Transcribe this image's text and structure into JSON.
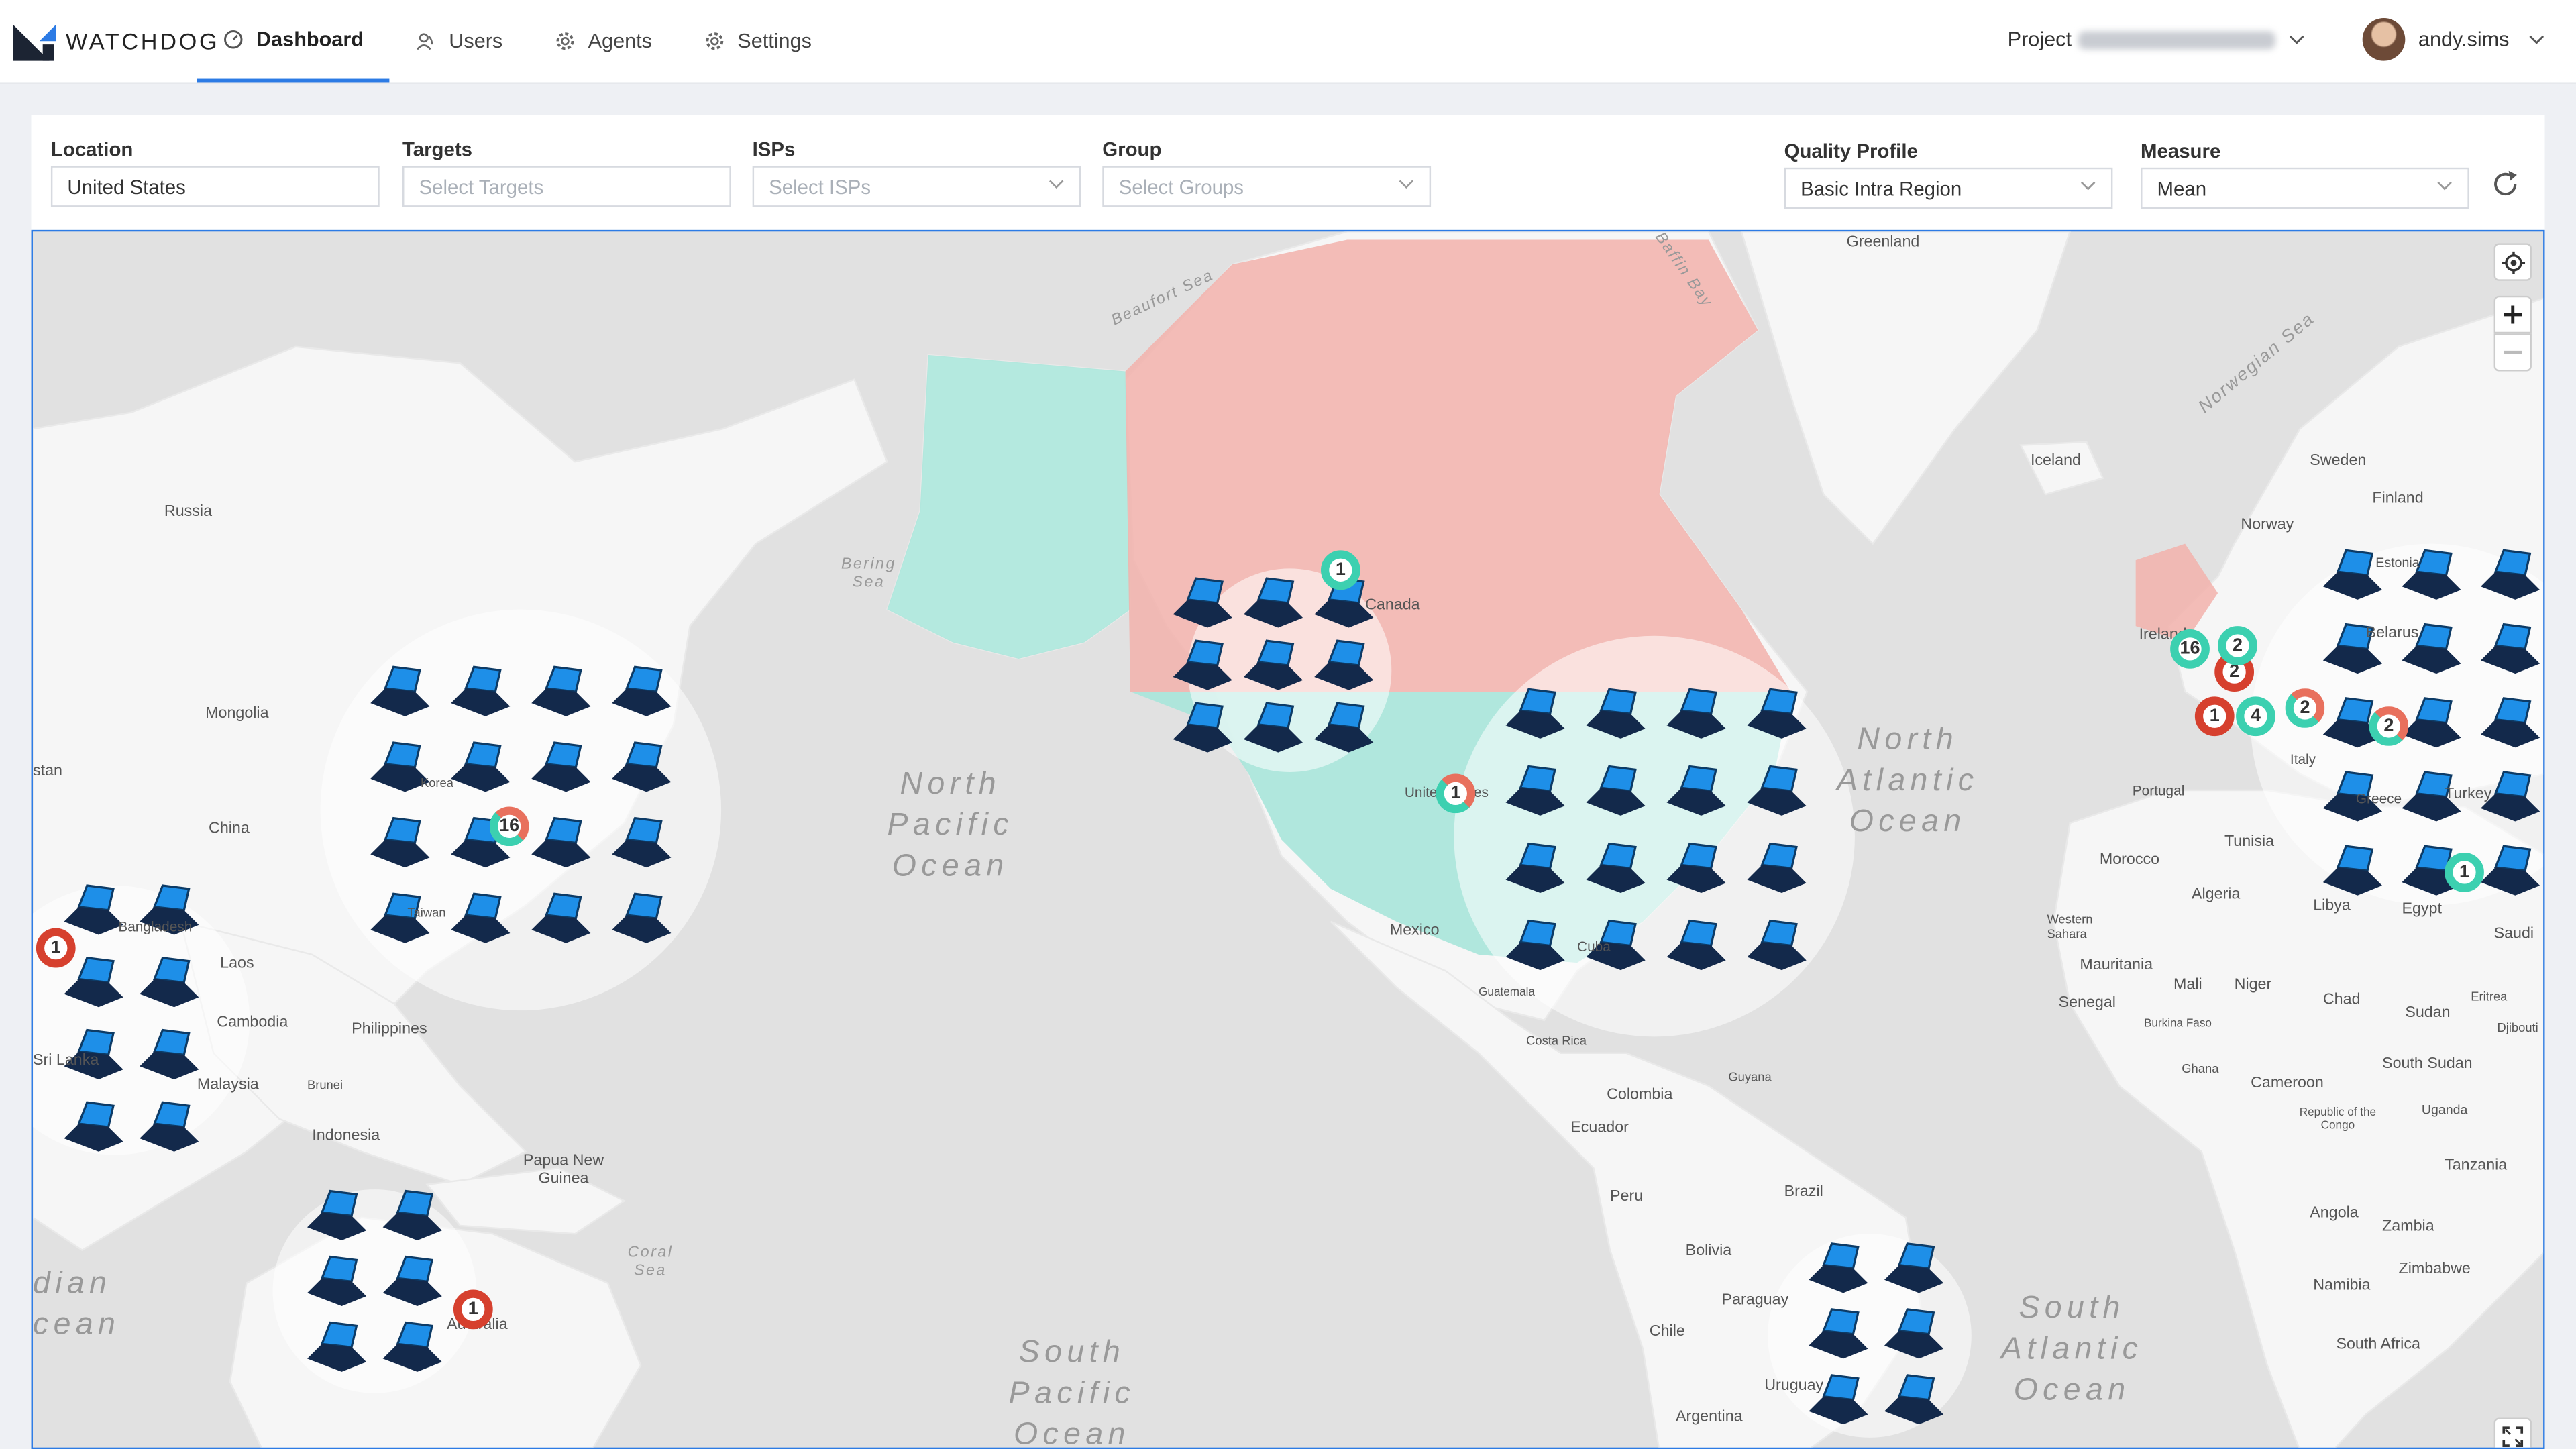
{
  "header": {
    "brand": "WATCHDOG",
    "nav": [
      {
        "label": "Dashboard",
        "icon": "gauge-icon",
        "active": true
      },
      {
        "label": "Users",
        "icon": "users-icon",
        "active": false
      },
      {
        "label": "Agents",
        "icon": "gear-icon",
        "active": false
      },
      {
        "label": "Settings",
        "icon": "gear-icon",
        "active": false
      }
    ],
    "project_label": "Project",
    "username": "andy.sims"
  },
  "filters": {
    "location": {
      "label": "Location",
      "value": "United States"
    },
    "targets": {
      "label": "Targets",
      "placeholder": "Select Targets"
    },
    "isps": {
      "label": "ISPs",
      "placeholder": "Select ISPs"
    },
    "group": {
      "label": "Group",
      "placeholder": "Select Groups"
    },
    "quality_profile": {
      "label": "Quality Profile",
      "value": "Basic Intra Region"
    },
    "measure": {
      "label": "Measure",
      "value": "Mean"
    }
  },
  "map": {
    "colors": {
      "good": "#3cd0b0",
      "bad": "#d6402e",
      "region_good": "#a8e6da",
      "region_bad": "#f2b1ab",
      "ocean": "#e1e1e1",
      "land": "#f6f6f6"
    },
    "country_labels": [
      "Greenland",
      "Russia",
      "Mongolia",
      "China",
      "Korea",
      "Taiwan",
      "Bangladesh",
      "Laos",
      "Cambodia",
      "Sri Lanka",
      "Malaysia",
      "Philippines",
      "Brunei",
      "Indonesia",
      "Papua New Guinea",
      "Canada",
      "United States",
      "Mexico",
      "Cuba",
      "Guatemala",
      "Costa Rica",
      "Colombia",
      "Guyana",
      "Ecuador",
      "Peru",
      "Brazil",
      "Bolivia",
      "Paraguay",
      "Chile",
      "Uruguay",
      "Argentina",
      "Iceland",
      "Sweden",
      "Finland",
      "Norway",
      "Estonia",
      "Belarus",
      "Ireland",
      "Portugal",
      "Italy",
      "Greece",
      "Turkey",
      "Tunisia",
      "Morocco",
      "Algeria",
      "Libya",
      "Egypt",
      "Western Sahara",
      "Mauritania",
      "Mali",
      "Niger",
      "Chad",
      "Sudan",
      "Eritrea",
      "Djibouti",
      "Senegal",
      "Burkina Faso",
      "Ghana",
      "Cameroon",
      "South Sudan",
      "Republic of the Congo",
      "Uganda",
      "Tanzania",
      "Angola",
      "Zambia",
      "Zimbabwe",
      "Namibia",
      "South Africa",
      "Saudi",
      "Australia",
      "stan"
    ],
    "oceans": [
      "North\nPacific\nOcean",
      "North\nAtlantic\nOcean",
      "South\nPacific\nOcean",
      "South\nAtlantic\nOcean",
      "dian\ncean"
    ],
    "seas": [
      "Beaufort Sea",
      "Baffin Bay",
      "Bering\nSea",
      "Norwegian Sea",
      "Coral\nSea"
    ],
    "clusters": [
      {
        "count": "1"
      },
      {
        "count": "16"
      },
      {
        "count": "1"
      },
      {
        "count": "1"
      },
      {
        "count": "16"
      },
      {
        "count": "2"
      },
      {
        "count": "2"
      },
      {
        "count": "1"
      },
      {
        "count": "4"
      },
      {
        "count": "2"
      },
      {
        "count": "2"
      },
      {
        "count": "1"
      },
      {
        "count": "1"
      }
    ]
  }
}
